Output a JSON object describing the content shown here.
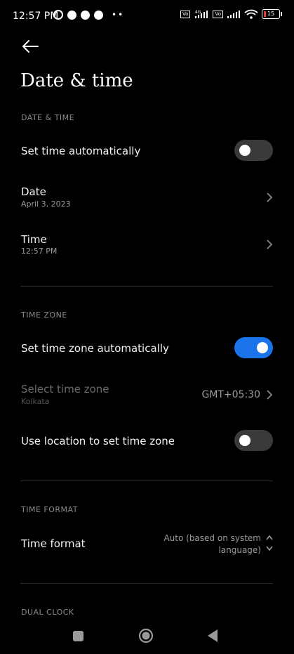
{
  "status_bar": {
    "time": "12:57 PM",
    "network": "4G",
    "battery": "15"
  },
  "header": {
    "title": "Date & time"
  },
  "sections": {
    "date_time": {
      "header": "DATE & TIME",
      "set_auto_label": "Set time automatically",
      "set_auto_on": false,
      "date_label": "Date",
      "date_value": "April 3, 2023",
      "time_label": "Time",
      "time_value": "12:57 PM"
    },
    "time_zone": {
      "header": "TIME ZONE",
      "set_zone_auto_label": "Set time zone automatically",
      "set_zone_auto_on": true,
      "select_zone_label": "Select time zone",
      "select_zone_sub": "Kolkata",
      "select_zone_value": "GMT+05:30",
      "use_location_label": "Use location to set time zone",
      "use_location_on": false
    },
    "time_format": {
      "header": "TIME FORMAT",
      "label": "Time format",
      "value": "Auto (based on system language)"
    },
    "dual_clock": {
      "header": "DUAL CLOCK"
    }
  },
  "colors": {
    "background": "#000000",
    "accent": "#1a73e8",
    "toggle_off": "#3a3a3a"
  },
  "icons": [
    "back-arrow-icon",
    "chevron-right-icon",
    "updown-icon",
    "recents-icon",
    "home-icon",
    "back-triangle-icon",
    "wifi-icon",
    "signal-icon",
    "battery-icon",
    "alarm-icon"
  ]
}
